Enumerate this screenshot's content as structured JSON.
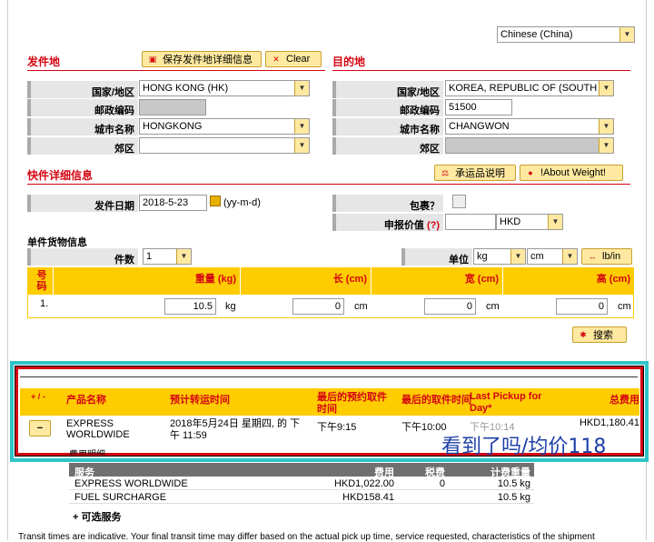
{
  "language_select": {
    "value": "Chinese (China)"
  },
  "origin": {
    "title": "发件地",
    "save_button": "保存发件地详细信息",
    "clear_button": "Clear",
    "country_label": "国家/地区",
    "country_value": "HONG KONG (HK)",
    "postal_label": "邮政编码",
    "postal_value": "",
    "city_label": "城市名称",
    "city_value": "HONGKONG",
    "suburb_label": "郊区",
    "suburb_value": ""
  },
  "destination": {
    "title": "目的地",
    "country_label": "国家/地区",
    "country_value": "KOREA, REPUBLIC OF (SOUTH K",
    "postal_label": "邮政编码",
    "postal_value": "51500",
    "city_label": "城市名称",
    "city_value": "CHANGWON",
    "suburb_label": "郊区",
    "suburb_value": ""
  },
  "shipment": {
    "title": "快件详细信息",
    "prohibited_button": "承运品说明",
    "weight_button": "!About Weight!",
    "date_label": "发件日期",
    "date_value": "2018-5-23",
    "date_format": "(yy-m-d)",
    "package_label": "包裹？",
    "declared_label": "申报价值",
    "declared_help": "(?)",
    "declared_value": "",
    "currency": "HKD",
    "piece_info_title": "单件货物信息",
    "pieces_label": "件数",
    "pieces_value": "1",
    "unit_label": "单位",
    "unit_weight": "kg",
    "unit_dim": "cm",
    "unit_toggle": "lb/in"
  },
  "piece_table": {
    "headers": [
      "号码",
      "重量 (kg)",
      "长 (cm)",
      "宽 (cm)",
      "高 (cm)"
    ],
    "row": {
      "num": "1.",
      "weight": "10.5",
      "weight_unit": "kg",
      "length": "0",
      "length_unit": "cm",
      "width": "0",
      "width_unit": "cm",
      "height": "0",
      "height_unit": "cm"
    }
  },
  "search_button": "搜索",
  "results": {
    "headers": {
      "toggle": "+ / -",
      "product": "产品名称",
      "transit": "预计转运时间",
      "booking": "最后的预约取件时间",
      "pickup": "最后的取件时间",
      "last_pickup": "Last Pickup for Day*",
      "total": "总费用"
    },
    "row": {
      "toggle": "−",
      "product": "EXPRESS WORLDWIDE",
      "transit": "2018年5月24日 星期四, 的 下午 11:59",
      "booking": "下午9:15",
      "pickup": "下午10:00",
      "last_pickup": "下午10:14",
      "total": "HKD1,180.41"
    },
    "detail_label": "费用明细"
  },
  "watermark": "看到了吗/均价118",
  "services": {
    "headers": {
      "service": "服务",
      "fee": "费用",
      "tax": "税费",
      "weight": "计费重量"
    },
    "rows": [
      {
        "service": "EXPRESS WORLDWIDE",
        "fee": "HKD1,022.00",
        "tax": "0",
        "weight": "10.5 kg"
      },
      {
        "service": "FUEL SURCHARGE",
        "fee": "HKD158.41",
        "tax": "",
        "weight": "10.5 kg"
      }
    ],
    "optional_label": "+ 可选服务"
  },
  "footnote": "Transit times are indicative. Your final transit time may differ based on the actual pick up time, service requested, characteristics of the shipment"
}
